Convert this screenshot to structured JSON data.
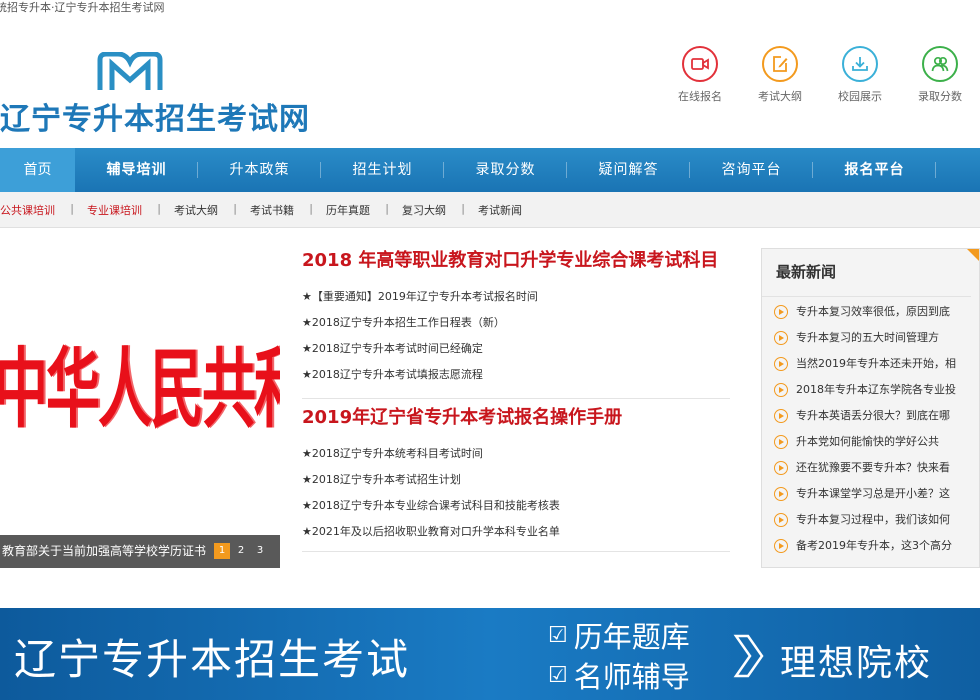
{
  "window_title": "统招专升本·辽宁专升本招生考试网",
  "logo": {
    "text": "辽宁专升本招生考试网"
  },
  "quick_links": [
    {
      "label": "在线报名",
      "icon": "video-camera-icon",
      "color": "#e2313a"
    },
    {
      "label": "考试大纲",
      "icon": "edit-icon",
      "color": "#f39a1e"
    },
    {
      "label": "校园展示",
      "icon": "download-tray-icon",
      "color": "#3ab0d8"
    },
    {
      "label": "录取分数",
      "icon": "users-icon",
      "color": "#3cb04a"
    }
  ],
  "nav": [
    "首页",
    "辅导培训",
    "升本政策",
    "招生计划",
    "录取分数",
    "疑问解答",
    "咨询平台",
    "报名平台"
  ],
  "subnav": [
    "公共课培训",
    "专业课培训",
    "考试大纲",
    "考试书籍",
    "历年真题",
    "复习大纲",
    "考试新闻"
  ],
  "slider": {
    "image_text": "中华人民共和国教育部",
    "caption": "教育部关于当前加强高等学校学历证书",
    "pages": [
      "1",
      "2",
      "3"
    ]
  },
  "articles": [
    {
      "title": "2018 年高等职业教育对口升学专业综合课考试科目",
      "items": [
        "★【重要通知】2019年辽宁专升本考试报名时间",
        "★2018辽宁专升本招生工作日程表（新）",
        "★2018辽宁专升本考试时间已经确定",
        "★2018辽宁专升本考试填报志愿流程"
      ]
    },
    {
      "title": "2019年辽宁省专升本考试报名操作手册",
      "items": [
        "★2018辽宁专升本统考科目考试时间",
        "★2018辽宁专升本考试招生计划",
        "★2018辽宁专升本专业综合课考试科目和技能考核表",
        "★2021年及以后招收职业教育对口升学本科专业名单"
      ]
    }
  ],
  "news": {
    "title": "最新新闻",
    "items": [
      "专升本复习效率很低，原因到底",
      "专升本复习的五大时间管理方",
      "当然2019年专升本还未开始，相",
      "2018年专升本辽东学院各专业投",
      "专升本英语丢分很大？到底在哪",
      "升本党如何能愉快的学好公共",
      "还在犹豫要不要专升本？快来看",
      "专升本课堂学习总是开小差？这",
      "专升本复习过程中，我们该如何",
      "备考2019年专升本，这3个高分"
    ]
  },
  "banner": {
    "main": "辽宁专升本招生考试",
    "features": [
      "历年题库",
      "名师辅导"
    ],
    "goal": "理想院校"
  }
}
